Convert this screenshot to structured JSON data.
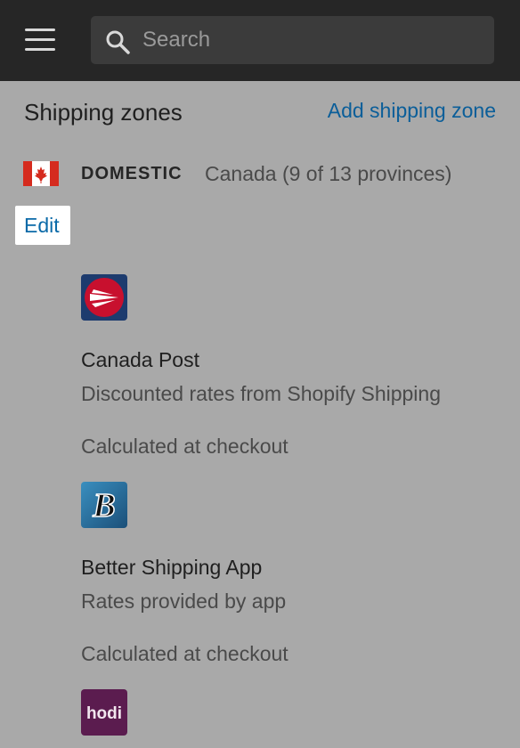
{
  "topbar": {
    "menu_icon": "hamburger-menu-icon",
    "search": {
      "placeholder": "Search",
      "icon": "search-icon"
    }
  },
  "zones": {
    "heading": "Shipping zones",
    "add_link": "Add shipping zone",
    "zone": {
      "flag_icon": "canada-flag-icon",
      "name": "DOMESTIC",
      "region": "Canada (9 of 13 provinces)",
      "edit_label": "Edit"
    }
  },
  "carriers": [
    {
      "logo": "canada-post-logo",
      "name": "Canada Post",
      "description": "Discounted rates from Shopify Shipping",
      "rate": "Calculated at checkout"
    },
    {
      "logo": "better-shipping-app-logo",
      "logo_text": "B",
      "name": "Better Shipping App",
      "description": "Rates provided by app",
      "rate": "Calculated at checkout"
    },
    {
      "logo": "hodi-logo",
      "logo_text": "hodi"
    }
  ],
  "colors": {
    "topbar": "#262626",
    "overlay": "#a9a9a9",
    "link": "#0b5e99",
    "canada_red": "#d52b1e",
    "canada_post_red": "#c8102e",
    "canada_post_blue": "#1d3b6e",
    "hodi_purple": "#5b1c4f"
  }
}
